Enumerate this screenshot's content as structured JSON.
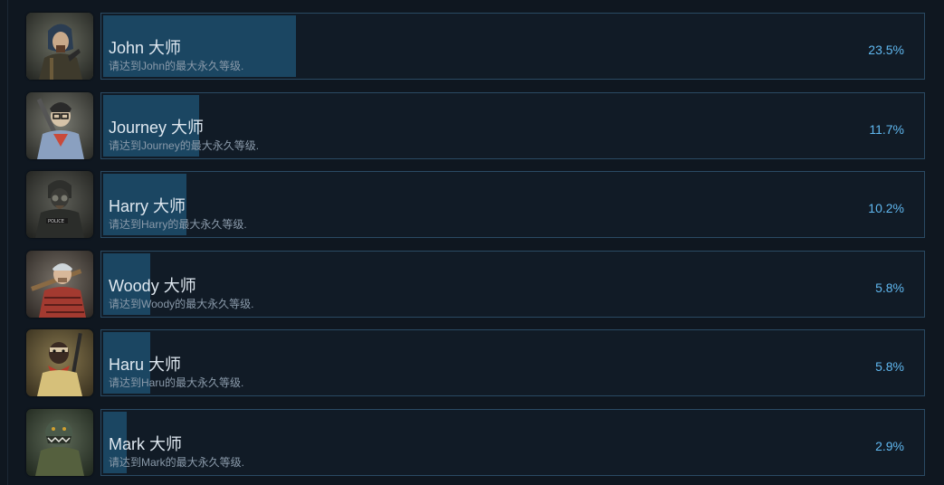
{
  "achievements": [
    {
      "name": "John 大师",
      "description": "请达到John的最大永久等级.",
      "percent_label": "23.5%",
      "percent": 23.5,
      "icon": "john-portrait"
    },
    {
      "name": "Journey 大师",
      "description": "请达到Journey的最大永久等级.",
      "percent_label": "11.7%",
      "percent": 11.7,
      "icon": "journey-portrait"
    },
    {
      "name": "Harry 大师",
      "description": "请达到Harry的最大永久等级.",
      "percent_label": "10.2%",
      "percent": 10.2,
      "icon": "harry-portrait"
    },
    {
      "name": "Woody 大师",
      "description": "请达到Woody的最大永久等级.",
      "percent_label": "5.8%",
      "percent": 5.8,
      "icon": "woody-portrait"
    },
    {
      "name": "Haru 大师",
      "description": "请达到Haru的最大永久等级.",
      "percent_label": "5.8%",
      "percent": 5.8,
      "icon": "haru-portrait"
    },
    {
      "name": "Mark 大师",
      "description": "请达到Mark的最大永久等级.",
      "percent_label": "2.9%",
      "percent": 2.9,
      "icon": "mark-portrait"
    }
  ],
  "colors": {
    "background": "#0f1720",
    "bar_border": "#2a4a63",
    "bar_fill": "#1b4662",
    "title_text": "#dfe8f0",
    "desc_text": "#8a9aaa",
    "percent_text": "#60b8f0"
  }
}
